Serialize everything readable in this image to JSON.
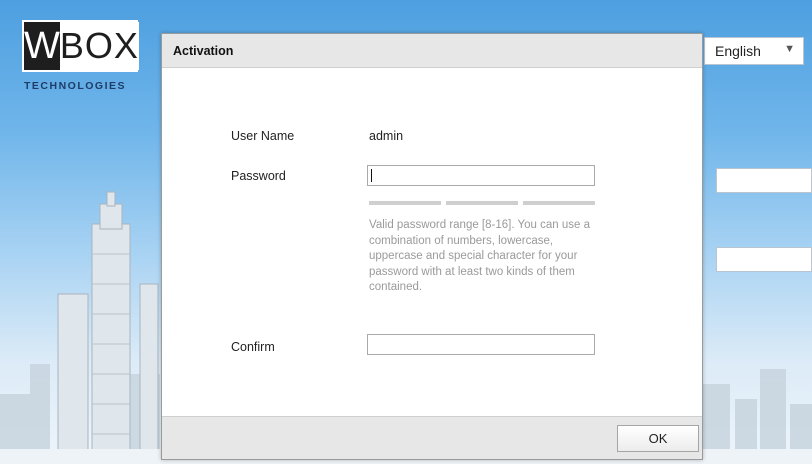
{
  "background": {
    "logo": {
      "letter": "W",
      "word": "BOX",
      "subtitle": "TECHNOLOGIES"
    },
    "language_select": {
      "value": "English",
      "icon": "chevron-down-icon"
    }
  },
  "dialog": {
    "title": "Activation",
    "user_name": {
      "label": "User Name",
      "value": "admin"
    },
    "password": {
      "label": "Password",
      "value": ""
    },
    "password_strength_segments": 3,
    "hint": "Valid password range [8-16]. You can use a combination of numbers, lowercase, uppercase and special character for your password with at least two kinds of them contained.",
    "confirm": {
      "label": "Confirm",
      "value": ""
    },
    "ok_label": "OK"
  },
  "colors": {
    "sky_top": "#4d9fe0",
    "dialog_bar": "#e7e7e7",
    "hint_text": "#9a9a9a"
  }
}
